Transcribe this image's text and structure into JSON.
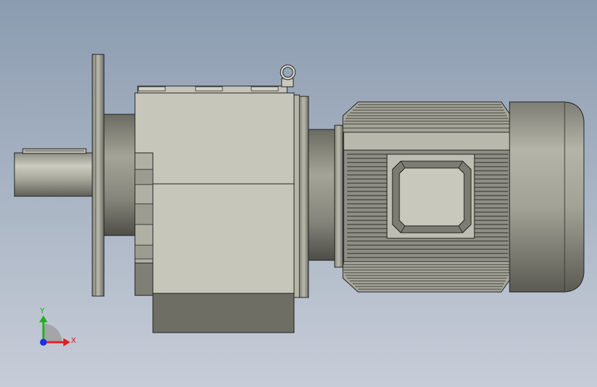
{
  "viewport": {
    "background_top": "#8b9cb0",
    "background_bottom": "#c7cdd8"
  },
  "colors": {
    "body_light": "#c6c6ba",
    "body_mid": "#a9a99d",
    "body_dark": "#6e6e64",
    "edge": "#1e1e1e"
  },
  "triad": {
    "x_label": "X",
    "y_label": "Y",
    "x_color": "#e0201e",
    "y_color": "#20b020",
    "z_color": "#1e2ee0"
  }
}
